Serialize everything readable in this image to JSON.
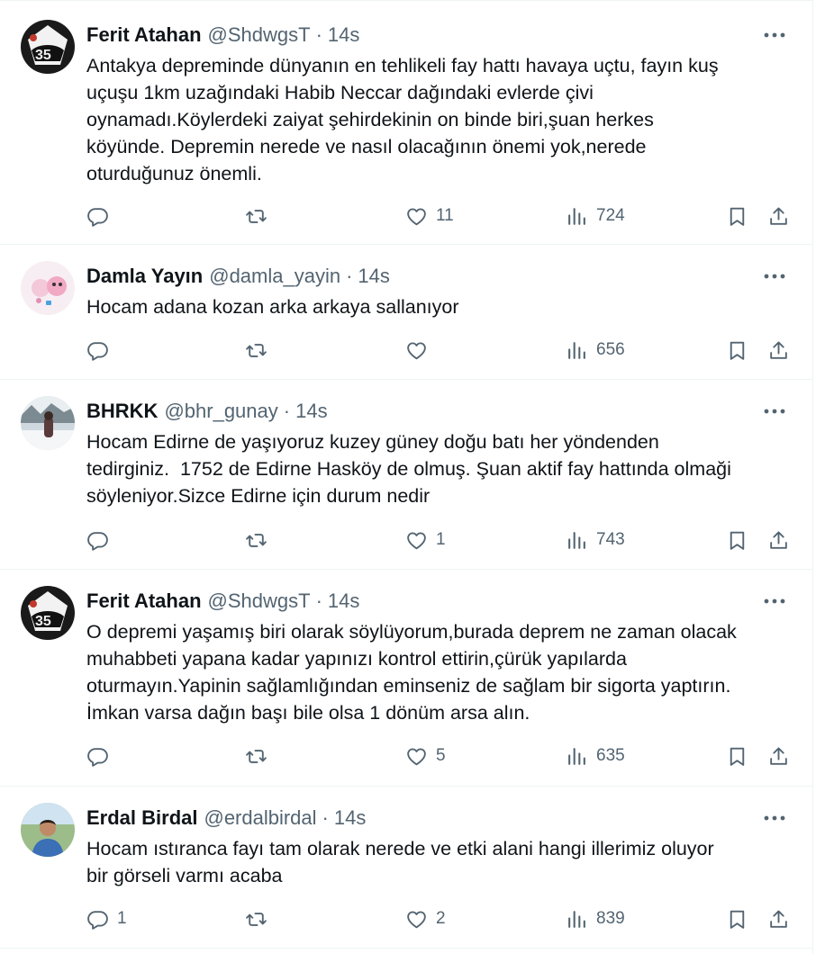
{
  "colors": {
    "text": "#0f1419",
    "muted": "#536471",
    "border": "#eff3f4"
  },
  "icons": [
    "more-icon",
    "reply-icon",
    "retweet-icon",
    "like-icon",
    "views-icon",
    "bookmark-icon",
    "share-icon"
  ],
  "tweets": [
    {
      "name": "Ferit Atahan",
      "handle": "@ShdwgsT",
      "sep": "·",
      "time": "14s",
      "text": "Antakya depreminde dünyanın en tehlikeli fay hattı havaya uçtu, fayın kuş\nuçuşu 1km uzağındaki Habib Neccar dağındaki evlerde çivi\noynamadı.Köylerdeki zaiyat şehirdekinin on binde biri,şuan herkes\nköyünde. Depremin nerede ve nasıl olacağının önemi yok,nerede\noturduğunuz önemli.",
      "replies": "",
      "likes": "11",
      "views": "724"
    },
    {
      "name": "Damla Yayın",
      "handle": "@damla_yayin",
      "sep": "·",
      "time": "14s",
      "text": "Hocam adana kozan arka arkaya sallanıyor",
      "replies": "",
      "likes": "",
      "views": "656"
    },
    {
      "name": "BHRKK",
      "handle": "@bhr_gunay",
      "sep": "·",
      "time": "14s",
      "text": "Hocam Edirne de yaşıyoruz kuzey güney doğu batı her yöndenden\ntedirginiz.  1752 de Edirne Hasköy de olmuş. Şuan aktif fay hattında olmaği\nsöyleniyor.Sizce Edirne için durum nedir",
      "replies": "",
      "likes": "1",
      "views": "743"
    },
    {
      "name": "Ferit Atahan",
      "handle": "@ShdwgsT",
      "sep": "·",
      "time": "14s",
      "text": "O depremi yaşamış biri olarak söylüyorum,burada deprem ne zaman olacak\nmuhabbeti yapana kadar yapınızı kontrol ettirin,çürük yapılarda\noturmayın.Yapinin sağlamlığından eminseniz de sağlam bir sigorta yaptırın.\nİmkan varsa dağın başı bile olsa 1 dönüm arsa alın.",
      "replies": "",
      "likes": "5",
      "views": "635"
    },
    {
      "name": "Erdal Birdal",
      "handle": "@erdalbirdal",
      "sep": "·",
      "time": "14s",
      "text": "Hocam ıstıranca fayı tam olarak nerede ve etki alani hangi illerimiz oluyor\nbir görseli varmı acaba",
      "replies": "1",
      "likes": "2",
      "views": "839"
    }
  ]
}
